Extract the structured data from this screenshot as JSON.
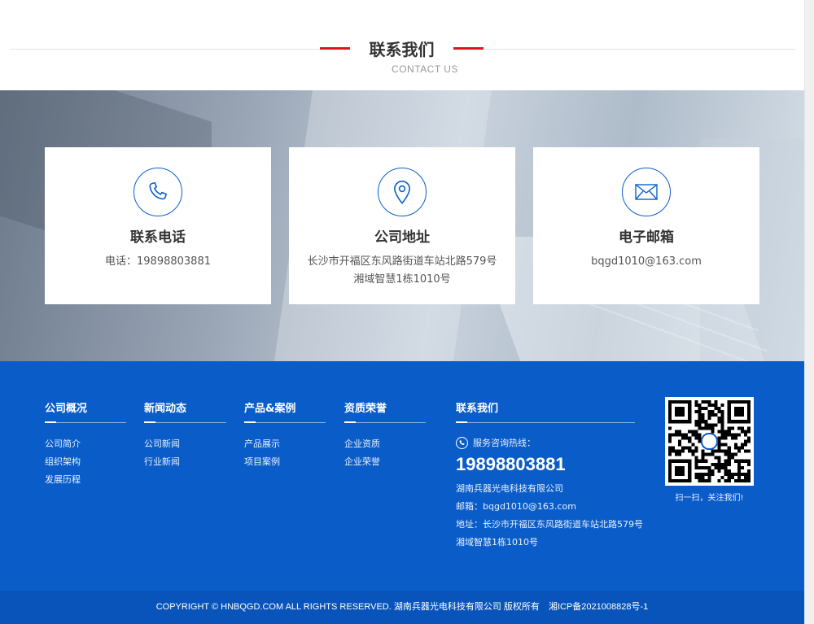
{
  "section": {
    "title": "联系我们",
    "subtitle": "CONTACT US"
  },
  "cards": [
    {
      "icon": "phone-icon",
      "title": "联系电话",
      "lines": [
        "电话：19898803881"
      ]
    },
    {
      "icon": "location-pin-icon",
      "title": "公司地址",
      "lines": [
        "长沙市开福区东风路街道车站北路579号",
        "湘域智慧1栋1010号"
      ]
    },
    {
      "icon": "mail-icon",
      "title": "电子邮箱",
      "lines": [
        "bqgd1010@163.com"
      ]
    }
  ],
  "footer": {
    "columns": [
      {
        "title": "公司概况",
        "links": [
          "公司简介",
          "组织架构",
          "发展历程"
        ]
      },
      {
        "title": "新闻动态",
        "links": [
          "公司新闻",
          "行业新闻"
        ]
      },
      {
        "title": "产品&案例",
        "links": [
          "产品展示",
          "项目案例"
        ]
      },
      {
        "title": "资质荣誉",
        "links": [
          "企业资质",
          "企业荣誉"
        ]
      }
    ],
    "contact": {
      "title": "联系我们",
      "hotline_label": "服务咨询热线：",
      "hotline_number": "19898803881",
      "company": "湖南兵器光电科技有限公司",
      "email": "邮箱：bqgd1010@163.com",
      "address_1": "地址：长沙市开福区东风路街道车站北路579号",
      "address_2": "湘域智慧1栋1010号"
    },
    "qr_caption": "扫一扫，关注我们!",
    "copyright": "COPYRIGHT © HNBQGD.COM ALL RIGHTS RESERVED. 湖南兵器光电科技有限公司 版权所有",
    "icp": "湘ICP备2021008828号-1"
  },
  "colors": {
    "accent_red": "#e0141e",
    "brand_blue": "#0a5dc9",
    "icon_blue": "#0a61c9"
  }
}
